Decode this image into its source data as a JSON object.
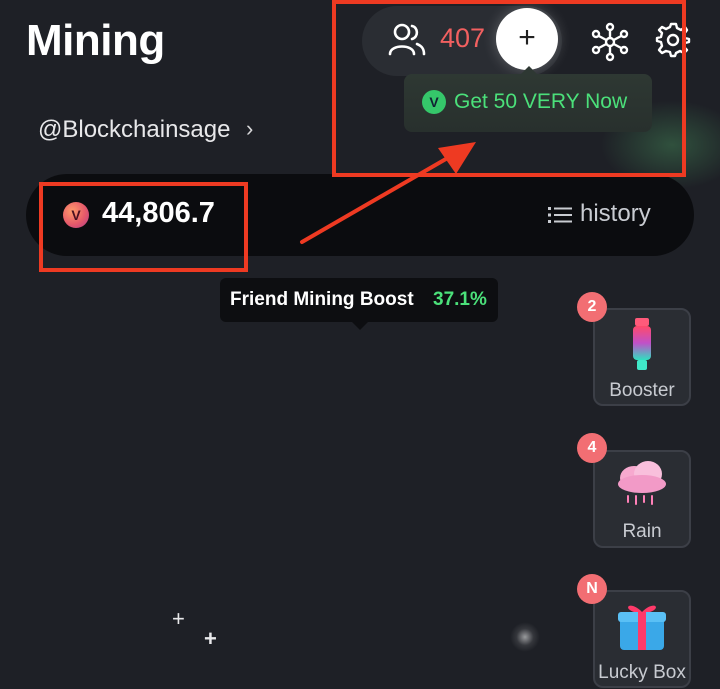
{
  "header": {
    "title": "Mining",
    "friends_count": "407",
    "plus_label": "+"
  },
  "tooltip_get": {
    "badge": "V",
    "text": "Get 50 VERY Now"
  },
  "user": {
    "username": "@Blockchainsage",
    "chevron": "›"
  },
  "balance": {
    "coin_badge": "V",
    "amount": "44,806.7",
    "history_label": "history"
  },
  "boost": {
    "label": "Friend Mining Boost",
    "value": "37.1%"
  },
  "side_items": [
    {
      "label": "Booster",
      "badge": "2"
    },
    {
      "label": "Rain",
      "badge": "4"
    },
    {
      "label": "Lucky Box",
      "badge": "N"
    }
  ],
  "sparkles": [
    "+",
    "+"
  ],
  "colors": {
    "background": "#1e2026",
    "accent_green": "#4be07a",
    "count_red": "#f26060",
    "annotation_red": "#ee3a22",
    "badge_red": "#f26e73"
  },
  "icons": [
    "friends-icon",
    "plus-icon",
    "network-icon",
    "gear-icon",
    "history-list-icon",
    "v-coin-icon",
    "booster-icon",
    "rain-cloud-icon",
    "gift-box-icon"
  ]
}
